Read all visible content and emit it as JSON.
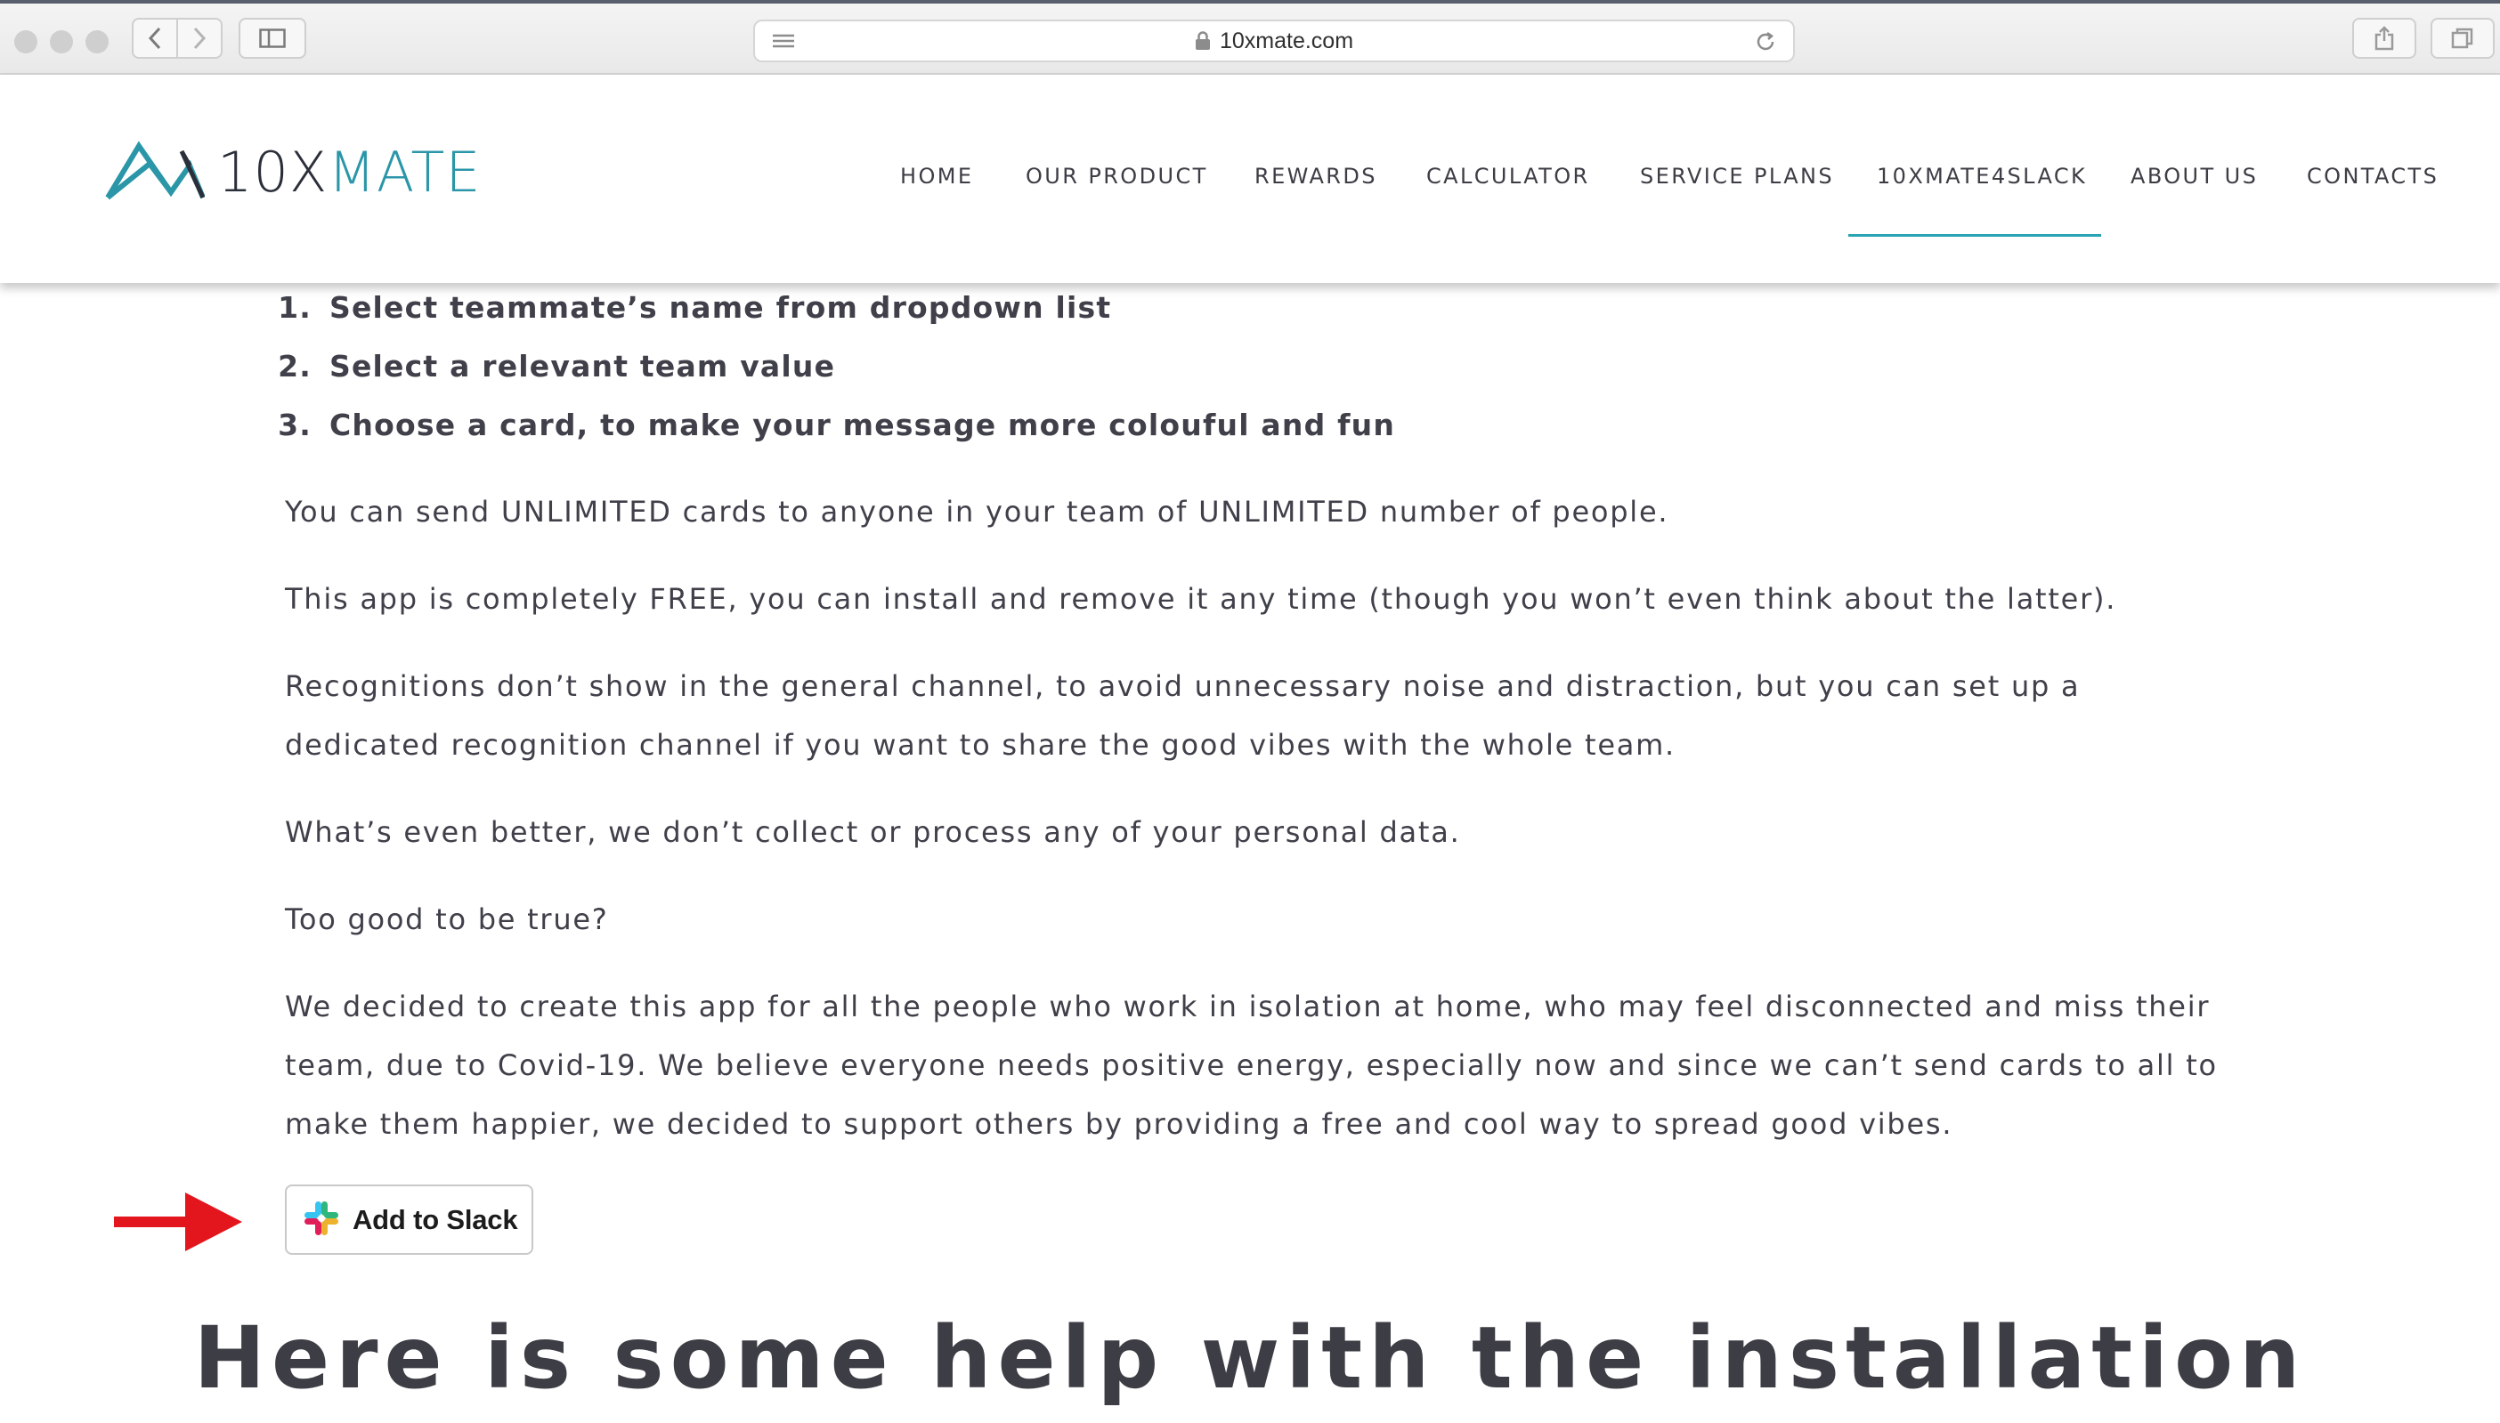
{
  "browser": {
    "url": "10xmate.com",
    "icons": {
      "back": "chevron-left-icon",
      "forward": "chevron-right-icon",
      "sidebar": "sidebar-icon",
      "reader": "reader-icon",
      "lock": "lock-icon",
      "reload": "reload-icon",
      "share": "share-icon",
      "tabs": "tabs-icon"
    }
  },
  "site": {
    "logo": {
      "prefix": "10X",
      "suffix": "MATE"
    },
    "nav": [
      {
        "label": "HOME"
      },
      {
        "label": "OUR PRODUCT"
      },
      {
        "label": "REWARDS"
      },
      {
        "label": "CALCULATOR"
      },
      {
        "label": "SERVICE PLANS"
      },
      {
        "label": "10XMATE4SLACK",
        "active": true
      },
      {
        "label": "ABOUT US"
      },
      {
        "label": "CONTACTS"
      }
    ],
    "accent_color": "#2aa3b5"
  },
  "content": {
    "steps": [
      {
        "num": "1.",
        "text": "Select teammate’s name from dropdown list"
      },
      {
        "num": "2.",
        "text": "Select a relevant team value"
      },
      {
        "num": "3.",
        "text": "Choose a card, to make your message more colouful and fun"
      }
    ],
    "paragraphs": [
      {
        "lines": [
          "You can send UNLIMITED cards to anyone in your team of UNLIMITED number of people."
        ]
      },
      {
        "lines": [
          "This app is completely FREE, you can install and remove it any time (though you won’t even think about the latter)."
        ]
      },
      {
        "lines": [
          "Recognitions don’t show in the general channel, to avoid unnecessary noise and distraction, but you can set up a",
          "dedicated recognition channel if you want to share the good vibes with the whole team."
        ]
      },
      {
        "lines": [
          "What’s even better, we don’t collect or process any of your personal data."
        ]
      },
      {
        "lines": [
          "Too good to be true?"
        ]
      },
      {
        "lines": [
          "We decided to create this app for all the people who work in isolation at home, who may feel disconnected and miss their",
          "team, due to Covid-19. We believe everyone needs positive energy, especially now and since we can’t send cards to all to",
          "make them happier, we decided to support others by providing a free and cool way to spread good vibes."
        ]
      }
    ],
    "slack_button": {
      "label": "Add to Slack",
      "icon": "slack-logo-icon"
    },
    "arrow_icon": "red-arrow-icon",
    "arrow_color": "#e3151d",
    "help_heading": "Here is some help with the installation"
  }
}
